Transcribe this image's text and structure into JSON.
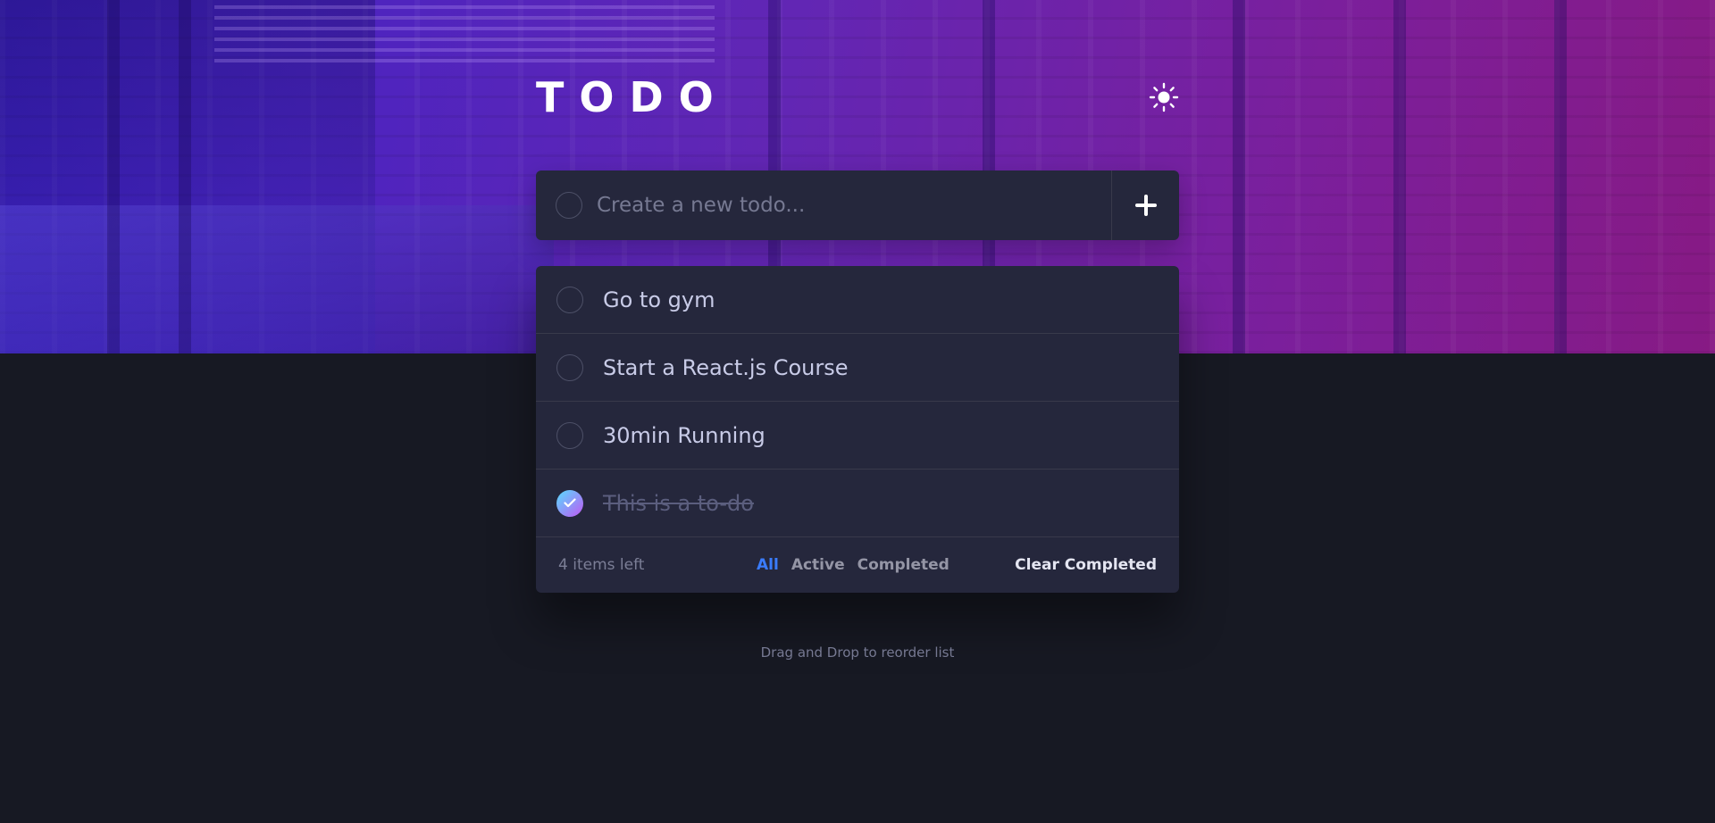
{
  "header": {
    "title": "TODO",
    "theme_icon": "sun-icon"
  },
  "new_todo": {
    "placeholder": "Create a new todo...",
    "add_icon": "plus-icon"
  },
  "todos": [
    {
      "text": "Go to gym",
      "completed": false
    },
    {
      "text": "Start a React.js Course",
      "completed": false
    },
    {
      "text": "30min Running",
      "completed": false
    },
    {
      "text": "This is a to-do",
      "completed": true
    }
  ],
  "footer": {
    "items_left": "4 items left",
    "filters": [
      "All",
      "Active",
      "Completed"
    ],
    "active_filter": "All",
    "clear_label": "Clear Completed"
  },
  "hint": "Drag and Drop to reorder list",
  "colors": {
    "accent": "#3a7cfd",
    "check_gradient_start": "#57ddff",
    "check_gradient_end": "#c058f3",
    "panel": "#25273c",
    "background": "#171923"
  }
}
